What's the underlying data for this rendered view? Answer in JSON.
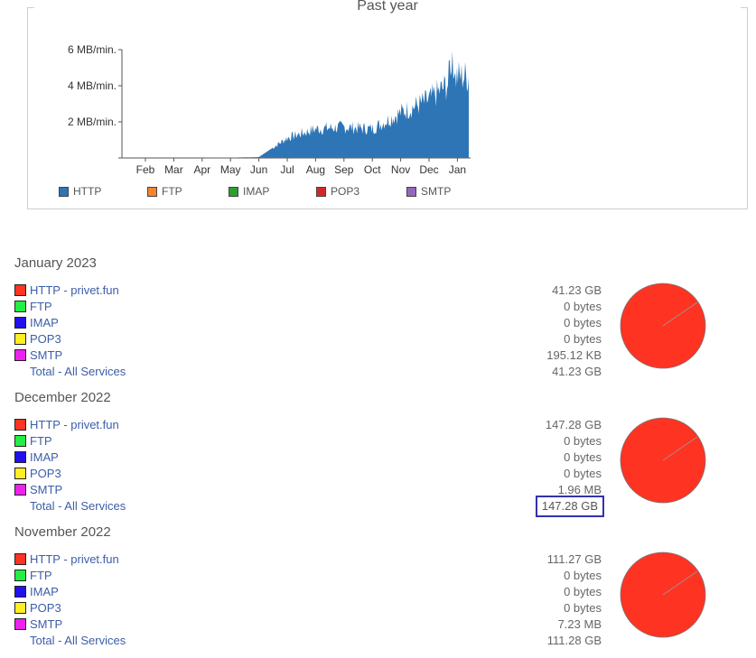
{
  "chart": {
    "title": "Past year",
    "y_ticks": [
      "6 MB/min.",
      "4 MB/min.",
      "2 MB/min."
    ],
    "x_ticks": [
      "Feb",
      "Mar",
      "Apr",
      "May",
      "Jun",
      "Jul",
      "Aug",
      "Sep",
      "Oct",
      "Nov",
      "Dec",
      "Jan"
    ],
    "legend": [
      {
        "label": "HTTP",
        "color": "#2e75b6"
      },
      {
        "label": "FTP",
        "color": "#f5862c"
      },
      {
        "label": "IMAP",
        "color": "#2ca02c"
      },
      {
        "label": "POP3",
        "color": "#d62728"
      },
      {
        "label": "SMTP",
        "color": "#9467bd"
      }
    ]
  },
  "chart_data": {
    "type": "area",
    "title": "Past year",
    "x": [
      "Feb",
      "Mar",
      "Apr",
      "May",
      "Jun",
      "Jul",
      "Aug",
      "Sep",
      "Oct",
      "Nov",
      "Dec",
      "Jan"
    ],
    "ylim": [
      0,
      6
    ],
    "series": [
      {
        "name": "HTTP",
        "values": [
          0,
          0,
          0,
          0.02,
          0.05,
          1.1,
          1.6,
          1.7,
          1.6,
          2.5,
          3.2,
          4.5
        ]
      },
      {
        "name": "FTP",
        "values": [
          0,
          0,
          0,
          0,
          0,
          0,
          0,
          0,
          0,
          0,
          0,
          0
        ]
      },
      {
        "name": "IMAP",
        "values": [
          0,
          0,
          0,
          0,
          0,
          0,
          0,
          0,
          0,
          0,
          0,
          0
        ]
      },
      {
        "name": "POP3",
        "values": [
          0,
          0,
          0,
          0,
          0,
          0,
          0,
          0,
          0,
          0,
          0,
          0
        ]
      },
      {
        "name": "SMTP",
        "values": [
          0,
          0,
          0,
          0,
          0,
          0,
          0,
          0,
          0,
          0,
          0,
          0
        ]
      }
    ]
  },
  "months": [
    {
      "title": "January 2023",
      "rows": [
        {
          "label": "HTTP - privet.fun",
          "value": "41.23 GB",
          "color": "#ff3322"
        },
        {
          "label": "FTP",
          "value": "0 bytes",
          "color": "#22ee44"
        },
        {
          "label": "IMAP",
          "value": "0 bytes",
          "color": "#2211ee"
        },
        {
          "label": "POP3",
          "value": "0 bytes",
          "color": "#ffee22"
        },
        {
          "label": "SMTP",
          "value": "195.12 KB",
          "color": "#ee22ee"
        }
      ],
      "total_label": "Total - All Services",
      "total_value": "41.23 GB"
    },
    {
      "title": "December 2022",
      "rows": [
        {
          "label": "HTTP - privet.fun",
          "value": "147.28 GB",
          "color": "#ff3322"
        },
        {
          "label": "FTP",
          "value": "0 bytes",
          "color": "#22ee44"
        },
        {
          "label": "IMAP",
          "value": "0 bytes",
          "color": "#2211ee"
        },
        {
          "label": "POP3",
          "value": "0 bytes",
          "color": "#ffee22"
        },
        {
          "label": "SMTP",
          "value": "1.96 MB",
          "color": "#ee22ee"
        }
      ],
      "total_label": "Total - All Services",
      "total_value": "147.28 GB"
    },
    {
      "title": "November 2022",
      "rows": [
        {
          "label": "HTTP - privet.fun",
          "value": "111.27 GB",
          "color": "#ff3322"
        },
        {
          "label": "FTP",
          "value": "0 bytes",
          "color": "#22ee44"
        },
        {
          "label": "IMAP",
          "value": "0 bytes",
          "color": "#2211ee"
        },
        {
          "label": "POP3",
          "value": "0 bytes",
          "color": "#ffee22"
        },
        {
          "label": "SMTP",
          "value": "7.23 MB",
          "color": "#ee22ee"
        }
      ],
      "total_label": "Total - All Services",
      "total_value": "111.28 GB"
    }
  ]
}
